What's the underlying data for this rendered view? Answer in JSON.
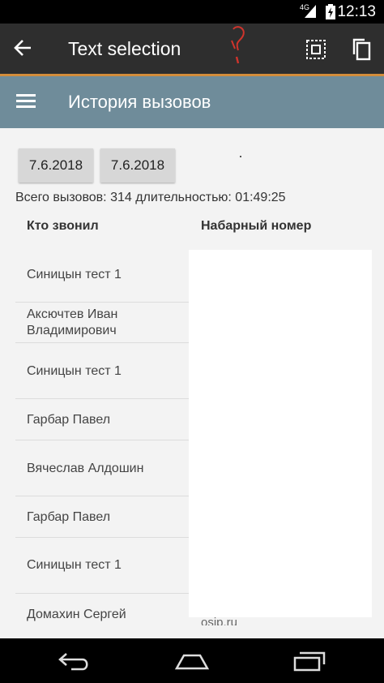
{
  "status_bar": {
    "network": "4G",
    "time": "12:13"
  },
  "action_bar": {
    "title": "Text selection"
  },
  "app_bar": {
    "title": "История вызовов"
  },
  "dates": {
    "from": "7.6.2018",
    "to": "7.6.2018"
  },
  "summary": "Всего вызовов: 314 длительностью: 01:49:25",
  "columns": {
    "caller": "Кто звонил",
    "dialed": "Набарный номер"
  },
  "rows": [
    "Синицын тест 1",
    "Аксючтев Иван Владимирович",
    "Синицын тест 1",
    "Гарбар Павел",
    "Вячеслав Алдошин",
    "Гарбар Павел",
    "Синицын тест 1",
    "Домахин Сергей"
  ],
  "partial_number": "osip.ru",
  "colors": {
    "action_bar": "#2e2e2e",
    "accent": "#d38d3b",
    "app_bar": "#6f8c9a",
    "background": "#f3f3f3",
    "date_button": "#d7d7d7"
  },
  "icons": [
    "back-arrow-icon",
    "select-all-icon",
    "copy-icon",
    "hamburger-menu-icon",
    "nav-back-icon",
    "nav-home-icon",
    "nav-recents-icon",
    "signal-icon",
    "battery-icon"
  ]
}
